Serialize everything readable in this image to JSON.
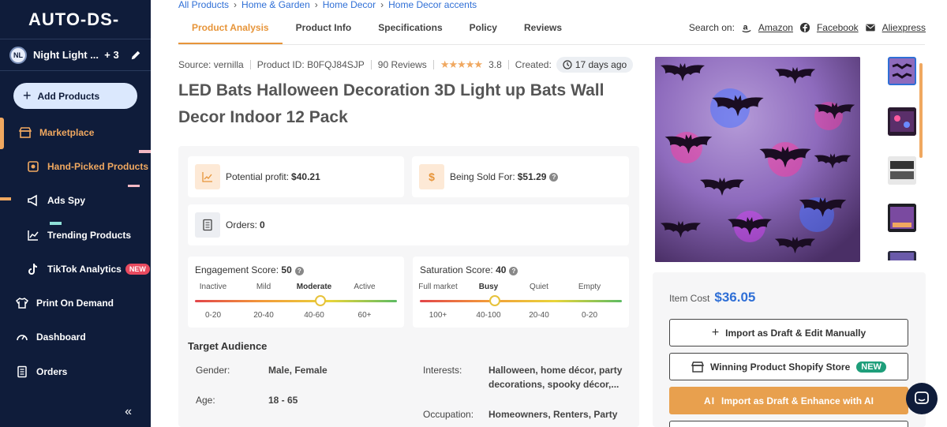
{
  "sidebar": {
    "logo": "AUTO-DS-",
    "store": {
      "initials": "NL",
      "name": "Night Light ...",
      "extra": "+ 3"
    },
    "add_products": "Add Products",
    "items": [
      {
        "label": "Marketplace",
        "icon": "store-icon"
      },
      {
        "label": "Hand-Picked Products",
        "icon": "hand-picked-icon"
      },
      {
        "label": "Ads Spy",
        "icon": "megaphone-icon"
      },
      {
        "label": "Trending Products",
        "icon": "chart-line-icon"
      },
      {
        "label": "TikTok Analytics",
        "icon": "tiktok-icon",
        "badge": "NEW"
      },
      {
        "label": "Print On Demand",
        "icon": "shirt-icon"
      },
      {
        "label": "Dashboard",
        "icon": "gauge-icon"
      },
      {
        "label": "Orders",
        "icon": "orders-icon"
      }
    ],
    "collapse": "«",
    "accent": "#f0a860",
    "bg": "#0f1c3a"
  },
  "breadcrumb": [
    "All Products",
    "Home & Garden",
    "Home Decor",
    "Home Decor accents"
  ],
  "tabs": [
    "Product Analysis",
    "Product Info",
    "Specifications",
    "Policy",
    "Reviews"
  ],
  "search_on": {
    "label": "Search on:",
    "links": [
      "Amazon",
      "Facebook",
      "Aliexpress"
    ]
  },
  "meta": {
    "source": "Source: vernilla",
    "product_id": "Product ID: B0FQJ84SJP",
    "reviews": "90 Reviews",
    "rating": "3.8",
    "created_label": "Created:",
    "created": "17 days ago"
  },
  "title": "LED Bats Halloween Decoration 3D Light up Bats Wall Decor Indoor 12 Pack",
  "profit": {
    "label": "Potential profit:",
    "value": "$40.21"
  },
  "sold_for": {
    "label": "Being Sold For:",
    "value": "$51.29",
    "icon_glyph": "$"
  },
  "orders": {
    "label": "Orders:",
    "value": "0"
  },
  "engagement": {
    "label": "Engagement Score:",
    "value": "50",
    "levels": [
      "Inactive",
      "Mild",
      "Moderate",
      "Active"
    ],
    "ranges": [
      "0-20",
      "20-40",
      "40-60",
      "60+"
    ],
    "selected": 2,
    "position": 0.62
  },
  "saturation": {
    "label": "Saturation Score:",
    "value": "40",
    "levels": [
      "Full market",
      "Busy",
      "Quiet",
      "Empty"
    ],
    "ranges": [
      "100+",
      "40-100",
      "20-40",
      "0-20"
    ],
    "selected": 1,
    "position": 0.37
  },
  "audience": {
    "title": "Target Audience",
    "gender_label": "Gender:",
    "gender": "Male, Female",
    "age_label": "Age:",
    "age": "18 - 65",
    "interests_label": "Interests:",
    "interests": "Halloween, home décor, party decorations, spooky décor,...",
    "occupation_label": "Occupation:",
    "occupation": "Homeowners, Renters, Party"
  },
  "buy": {
    "cost_label": "Item Cost",
    "cost": "$36.05",
    "import_manual": "Import as Draft & Edit Manually",
    "winning": "Winning Product Shopify Store",
    "winning_badge": "NEW",
    "import_ai": "Import as Draft & Enhance with AI",
    "ai_glyph": "AI"
  }
}
